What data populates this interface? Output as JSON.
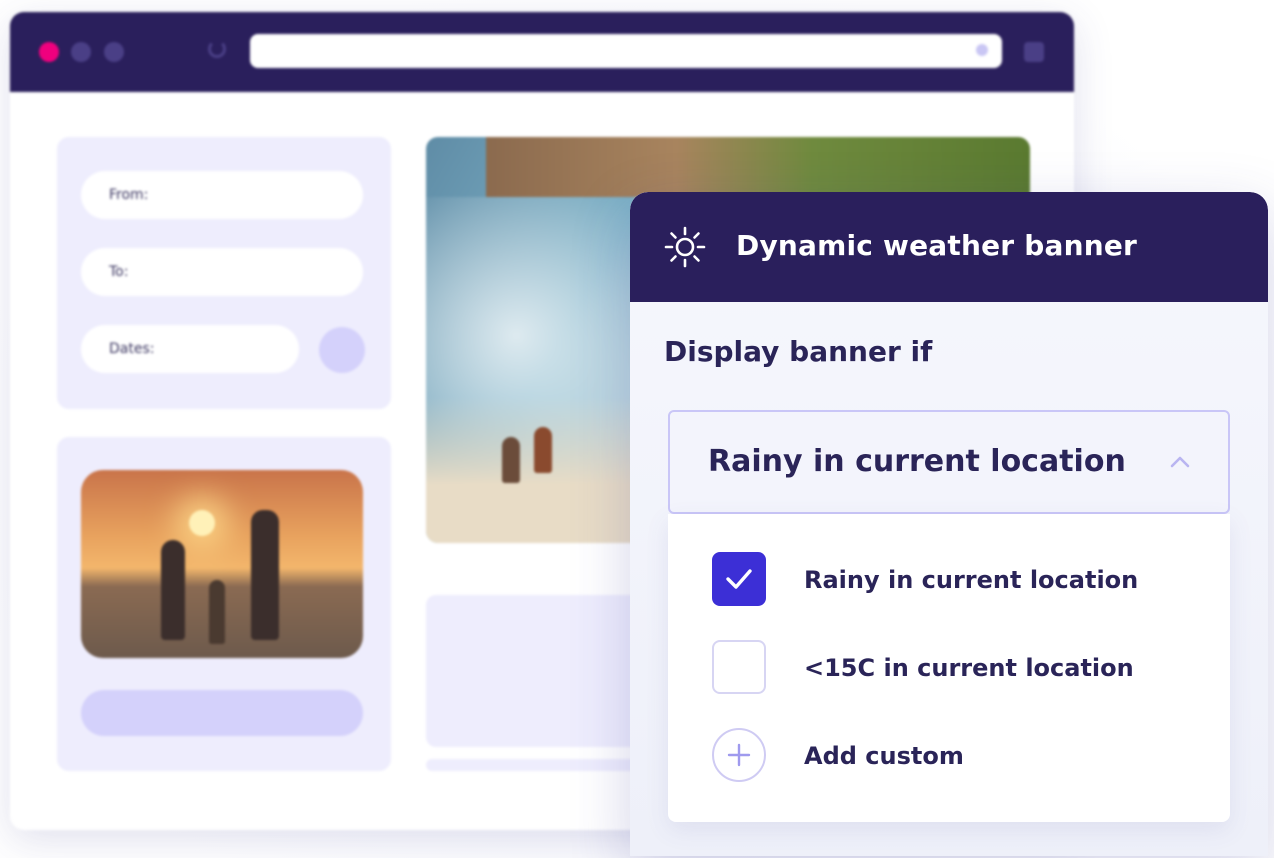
{
  "browser": {
    "form": {
      "from_label": "From:",
      "to_label": "To:",
      "dates_label": "Dates:"
    }
  },
  "panel": {
    "title": "Dynamic weather banner",
    "header_icon": "sun-icon",
    "display_label": "Display banner if",
    "dropdown": {
      "selected": "Rainy in current location",
      "expanded": true
    },
    "options": [
      {
        "label": "Rainy in current location",
        "checked": true
      },
      {
        "label": "<15C in current location",
        "checked": false
      }
    ],
    "add_custom_label": "Add custom"
  },
  "colors": {
    "brand_dark": "#2a1f5c",
    "accent": "#3c2fd6",
    "window_close_dot": "#f0007e",
    "panel_tint": "#eeedfd"
  }
}
